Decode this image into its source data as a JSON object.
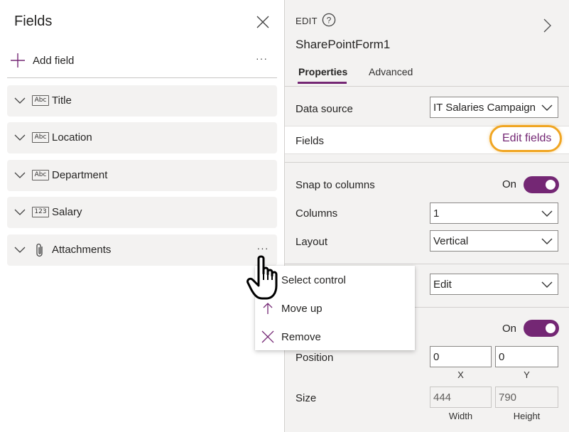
{
  "fields_pane": {
    "title": "Fields",
    "add_field_label": "Add field",
    "more_label": "···",
    "fields": [
      {
        "name": "Title",
        "type": "Abc"
      },
      {
        "name": "Location",
        "type": "Abc"
      },
      {
        "name": "Department",
        "type": "Abc"
      },
      {
        "name": "Salary",
        "type": "123"
      },
      {
        "name": "Attachments",
        "type": "attachment"
      }
    ]
  },
  "context_menu": {
    "items": [
      {
        "label": "Select control",
        "icon": "select-icon"
      },
      {
        "label": "Move up",
        "icon": "arrow-up-icon"
      },
      {
        "label": "Remove",
        "icon": "close-icon"
      }
    ]
  },
  "properties": {
    "mode": "EDIT",
    "form_name": "SharePointForm1",
    "tabs": [
      {
        "label": "Properties",
        "active": true
      },
      {
        "label": "Advanced",
        "active": false
      }
    ],
    "data_source_label": "Data source",
    "data_source_value": "IT Salaries Campaign",
    "fields_label": "Fields",
    "edit_fields_label": "Edit fields",
    "snap_label": "Snap to columns",
    "snap_state": "On",
    "columns_label": "Columns",
    "columns_value": "1",
    "layout_label": "Layout",
    "layout_value": "Vertical",
    "mode_value": "Edit",
    "visible_state": "On",
    "position_label": "Position",
    "position_x": "0",
    "position_y": "0",
    "x_label": "X",
    "y_label": "Y",
    "size_label": "Size",
    "width_value": "444",
    "height_value": "790",
    "width_label": "Width",
    "height_label": "Height"
  },
  "colors": {
    "accent": "#742774",
    "highlight": "#f0a521",
    "panel_bg": "#f3f2f1"
  }
}
